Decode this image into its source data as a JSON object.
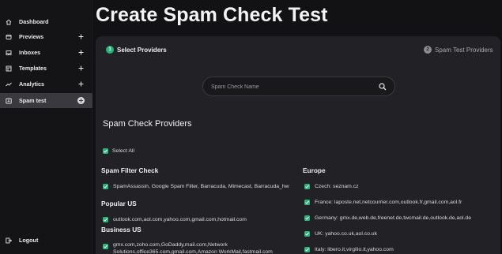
{
  "sidebar": {
    "items": [
      {
        "label": "Dashboard",
        "icon": "home-icon",
        "has_plus": false
      },
      {
        "label": "Previews",
        "icon": "previews-icon",
        "has_plus": true
      },
      {
        "label": "Inboxes",
        "icon": "inbox-icon",
        "has_plus": true
      },
      {
        "label": "Templates",
        "icon": "templates-icon",
        "has_plus": true
      },
      {
        "label": "Analytics",
        "icon": "analytics-icon",
        "has_plus": true
      },
      {
        "label": "Spam test",
        "icon": "spam-test-icon",
        "has_plus": true,
        "active": true
      }
    ],
    "logout_label": "Logout"
  },
  "page": {
    "title": "Create Spam Check Test"
  },
  "steps": [
    {
      "num": "1",
      "label": "Select Providers",
      "active": true
    },
    {
      "num": "2",
      "label": "Spam Test Providers",
      "active": false
    }
  ],
  "search": {
    "placeholder": "Spam Check Name",
    "value": ""
  },
  "providers": {
    "title": "Spam Check Providers",
    "select_all_label": "Select All",
    "select_all_checked": true,
    "left_groups": [
      {
        "title": "Spam Filter Check",
        "items": [
          "SpamAssassin, Google Spam Filter, Barracuda, Mimecast, Barracuda_hw"
        ]
      },
      {
        "title": "Popular US",
        "items": [
          "outlook.com,aol.com,yahoo.com,gmail.com,hotmail.com"
        ]
      },
      {
        "title": "Business US",
        "items": [
          "gmx.com,zoho.com,GoDaddy,mail.com,Network Solutions,office365.com,gmail.com,Amazon WorkMail,fastmail.com"
        ]
      }
    ],
    "right_groups": [
      {
        "title": "Europe",
        "items": [
          "Czech: seznam.cz",
          "France: laposte.net,netcourrier.com,outlook.fr,gmail.com,aol.fr",
          "Germany: gmx.de,web.de,freenet.de,twcmail.de,outlook.de,aol.de",
          "UK: yahoo.co.uk,aol.co.uk",
          "Italy: libero.it,virgilio.it,yahoo.com"
        ]
      }
    ]
  },
  "colors": {
    "accent": "#27b37a",
    "background": "#121214",
    "panel": "#222226",
    "active_nav": "#3a3a3e"
  }
}
